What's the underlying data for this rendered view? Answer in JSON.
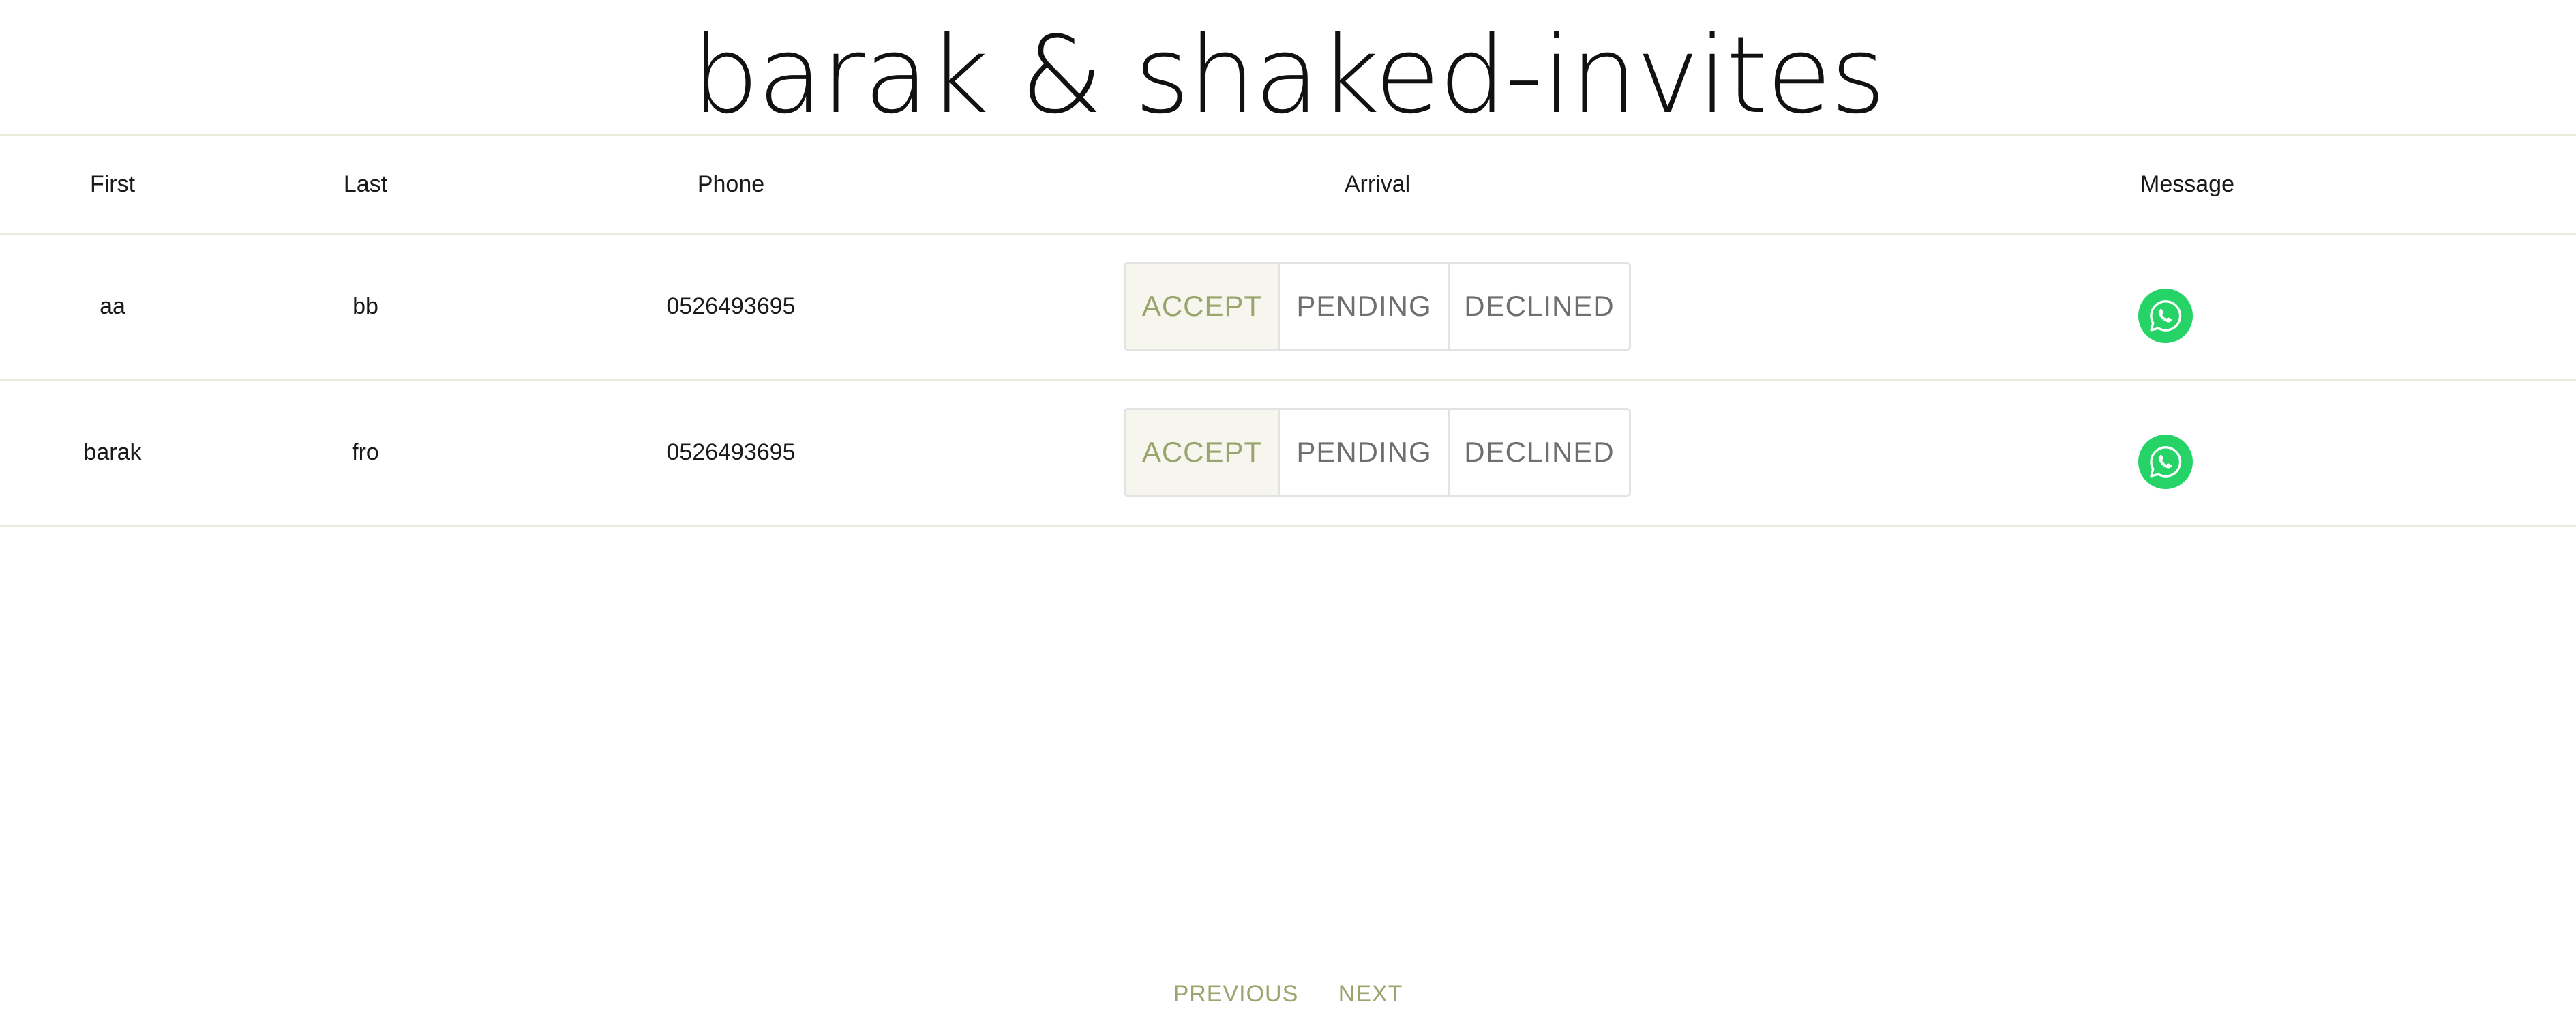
{
  "title": "barak & shaked-invites",
  "table": {
    "columns": {
      "first": "First",
      "last": "Last",
      "phone": "Phone",
      "arrival": "Arrival",
      "message": "Message"
    },
    "rows": [
      {
        "first": "aa",
        "last": "bb",
        "phone": "0526493695",
        "arrival": "accept"
      },
      {
        "first": "barak",
        "last": "fro",
        "phone": "0526493695",
        "arrival": "accept"
      }
    ]
  },
  "arrival_options": {
    "accept": "ACCEPT",
    "pending": "PENDING",
    "declined": "DECLINED"
  },
  "message_icon": "whatsapp-icon",
  "pagination": {
    "previous": "PREVIOUS",
    "next": "NEXT"
  },
  "colors": {
    "accent": "#9ba46d",
    "selected_bg": "#f6f6ee",
    "divider": "#e9ecd8",
    "whatsapp": "#25d366"
  }
}
